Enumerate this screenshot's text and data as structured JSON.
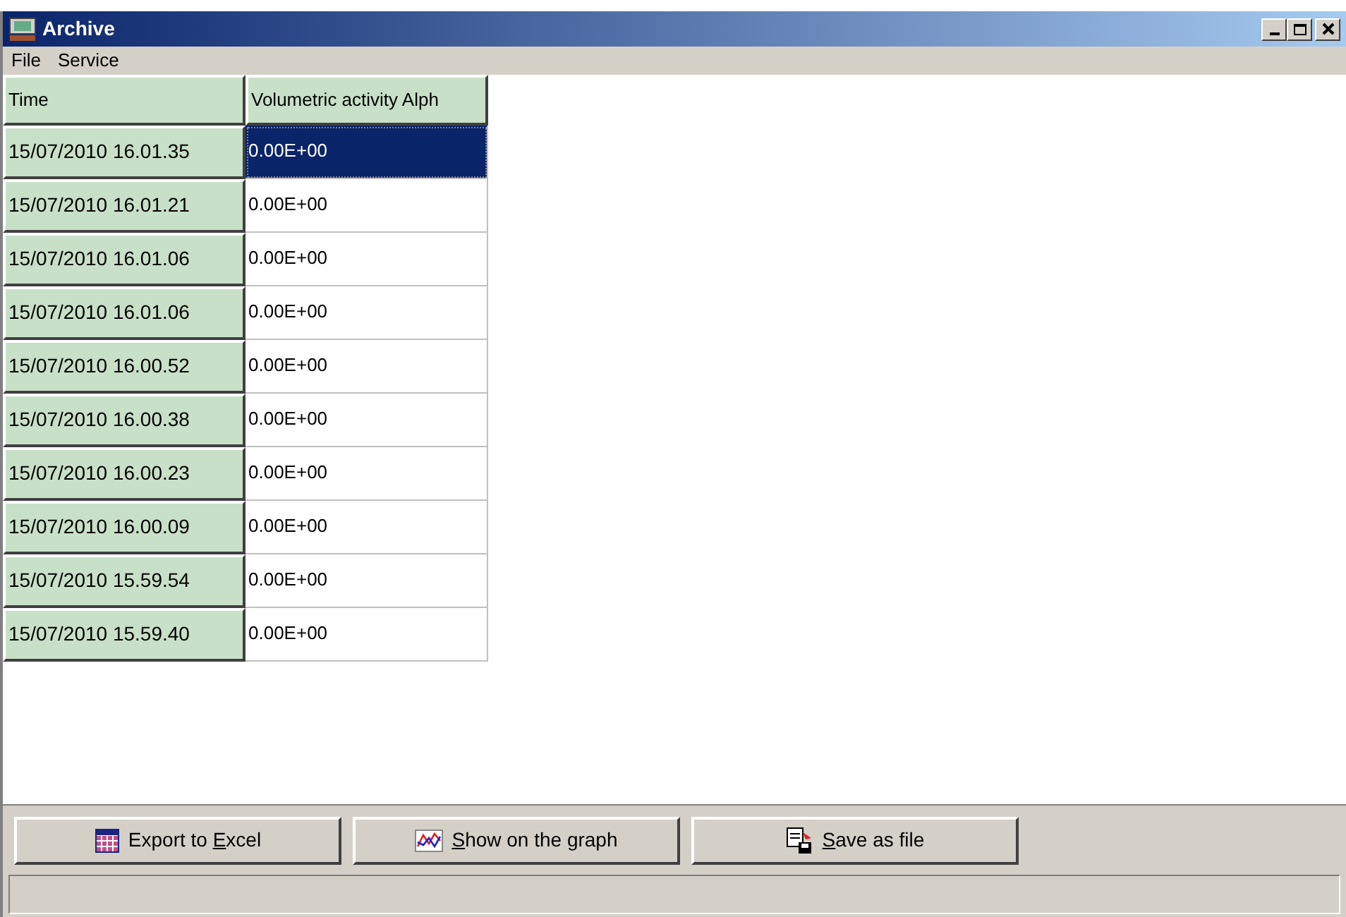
{
  "window": {
    "title": "Archive"
  },
  "menu": [
    "File",
    "Service"
  ],
  "table": {
    "columns": [
      "Time",
      "Volumetric activity Alph"
    ],
    "rows": [
      {
        "time": "15/07/2010 16.01.35",
        "value": "0.00E+00",
        "selected": true
      },
      {
        "time": "15/07/2010 16.01.21",
        "value": "0.00E+00",
        "selected": false
      },
      {
        "time": "15/07/2010 16.01.06",
        "value": "0.00E+00",
        "selected": false
      },
      {
        "time": "15/07/2010 16.01.06",
        "value": "0.00E+00",
        "selected": false
      },
      {
        "time": "15/07/2010 16.00.52",
        "value": "0.00E+00",
        "selected": false
      },
      {
        "time": "15/07/2010 16.00.38",
        "value": "0.00E+00",
        "selected": false
      },
      {
        "time": "15/07/2010 16.00.23",
        "value": "0.00E+00",
        "selected": false
      },
      {
        "time": "15/07/2010 16.00.09",
        "value": "0.00E+00",
        "selected": false
      },
      {
        "time": "15/07/2010 15.59.54",
        "value": "0.00E+00",
        "selected": false
      },
      {
        "time": "15/07/2010 15.59.40",
        "value": "0.00E+00",
        "selected": false
      }
    ]
  },
  "buttons": [
    {
      "kind": "excel",
      "before": "Export to ",
      "accel": "E",
      "after": "xcel"
    },
    {
      "kind": "graph",
      "accel": "S",
      "after": "how on the graph"
    },
    {
      "kind": "save",
      "accel": "S",
      "after": "ave as file"
    }
  ]
}
